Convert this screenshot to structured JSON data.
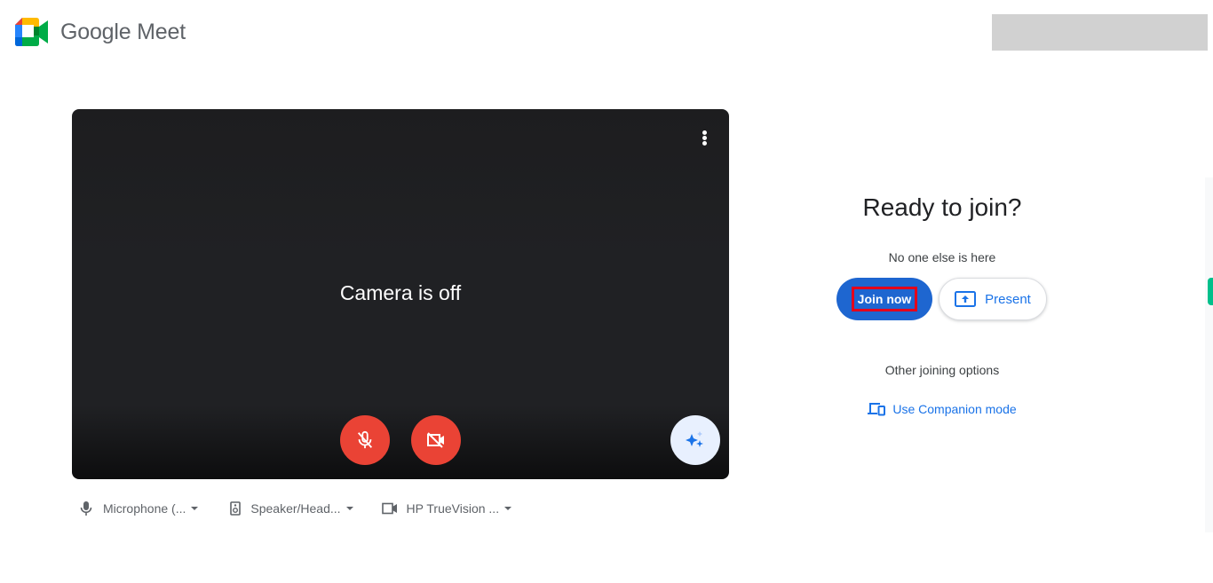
{
  "header": {
    "app_name": "Google Meet",
    "logo_icon": "google-meet-logo-icon"
  },
  "preview": {
    "camera_status": "Camera is off",
    "more_options_icon": "more-vert-icon",
    "mic_button": {
      "icon": "mic-off-icon",
      "state": "off"
    },
    "camera_button": {
      "icon": "videocam-off-icon",
      "state": "off"
    },
    "effects_button": {
      "icon": "sparkle-effects-icon"
    }
  },
  "devices": [
    {
      "icon": "microphone-icon",
      "label": "Microphone (..."
    },
    {
      "icon": "speaker-icon",
      "label": "Speaker/Head..."
    },
    {
      "icon": "videocam-icon",
      "label": "HP TrueVision ..."
    }
  ],
  "join_panel": {
    "title": "Ready to join?",
    "status": "No one else is here",
    "join_button": "Join now",
    "present_button": "Present",
    "other_options_title": "Other joining options",
    "companion_link": "Use Companion mode"
  },
  "colors": {
    "primary_blue": "#1a73e8",
    "danger_red": "#ea4335",
    "highlight_box": "#e4001b"
  }
}
